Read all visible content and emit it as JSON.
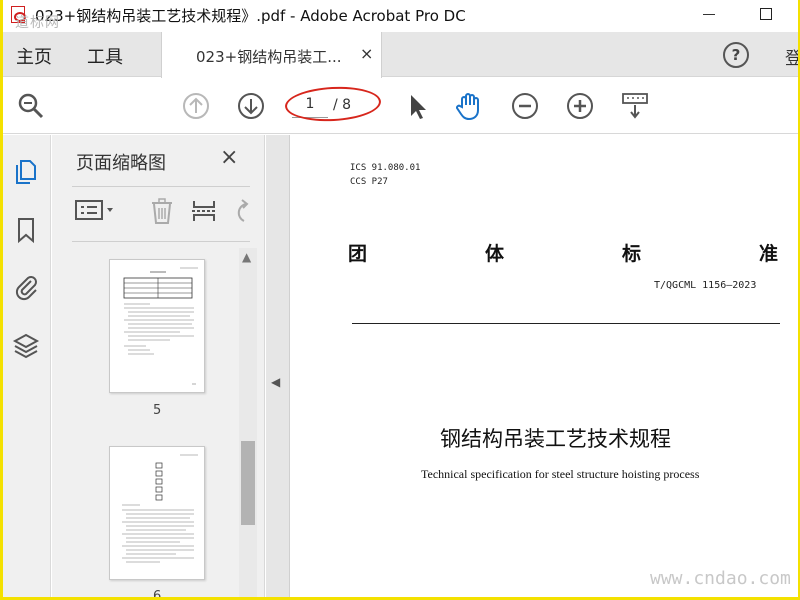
{
  "window": {
    "title": "023+钢结构吊装工艺技术规程》.pdf - Adobe Acrobat Pro DC",
    "watermark_top": "道标网"
  },
  "menubar": {
    "home": "主页",
    "tools": "工具",
    "doc_tab_label": "023+钢结构吊装工...",
    "doc_tab_close": "×",
    "help_icon": "?",
    "signin": "登"
  },
  "toolbar": {
    "current_page": "1",
    "total_pages": "/ 8",
    "icons": [
      "search-zoom-icon",
      "page-up-icon",
      "page-down-icon",
      "select-arrow-icon",
      "hand-tool-icon",
      "zoom-out-icon",
      "zoom-in-icon",
      "keyboard-scroll-icon"
    ],
    "accent_color": "#1a73c9",
    "annotation_color": "#d7261c"
  },
  "thumbnail_panel": {
    "title": "页面缩略图",
    "close": "×",
    "thumbnails": [
      {
        "page_label": "5"
      },
      {
        "page_label": "6"
      }
    ]
  },
  "document": {
    "ics": "ICS 91.080.01",
    "ccs": "CCS P27",
    "header_chars": [
      "团",
      "体",
      "标",
      "准"
    ],
    "standard_number": "T/QGCML 1156—2023",
    "title_cn": "钢结构吊装工艺技术规程",
    "title_en": "Technical specification for steel structure hoisting process"
  },
  "watermark_bottom": "www.cndao.com"
}
